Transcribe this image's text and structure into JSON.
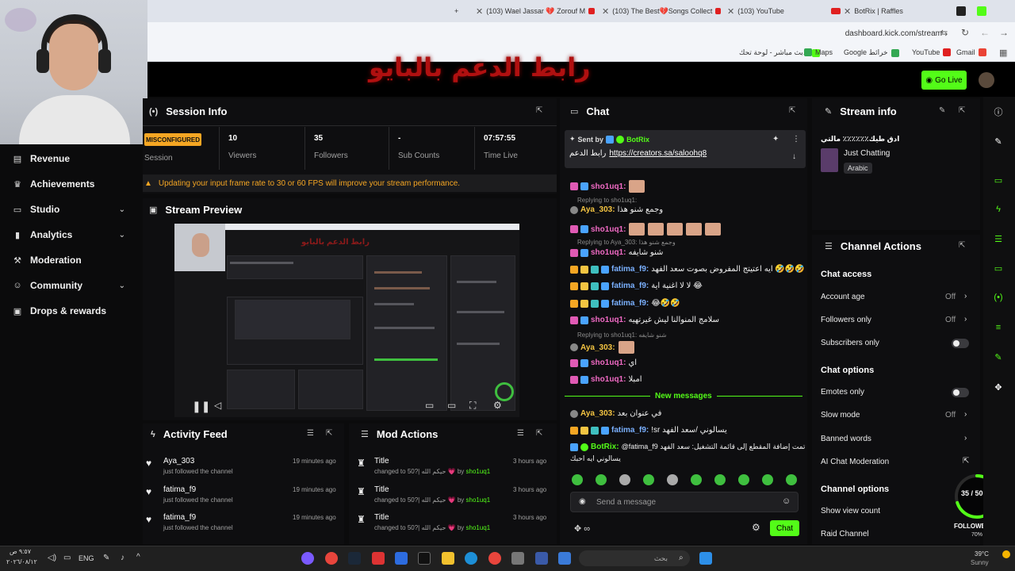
{
  "browser": {
    "new_tab": "+",
    "tabs": [
      {
        "title": "(103) Wael Jassar 💔 Zorouf M"
      },
      {
        "title": "(103) The Best💔Songs Collect"
      },
      {
        "title": "(103) YouTube"
      },
      {
        "title": "BotRix | Raffles"
      }
    ],
    "url": "dashboard.kick.com/stream",
    "bookmarks": [
      "بث مباشر - لوحة تحك...",
      "Maps",
      "Google خرائط",
      "YouTube",
      "Gmail"
    ]
  },
  "overlay_banner": "رابط الدعم بالبايو",
  "header": {
    "go_live": "Go Live"
  },
  "sidebar": {
    "items": [
      {
        "label": "Revenue"
      },
      {
        "label": "Achievements"
      },
      {
        "label": "Studio"
      },
      {
        "label": "Analytics"
      },
      {
        "label": "Moderation"
      },
      {
        "label": "Community"
      },
      {
        "label": "Drops & rewards"
      }
    ]
  },
  "session": {
    "title": "Session Info",
    "status": "MISCONFIGURED",
    "status_label": "Session",
    "viewers_value": "10",
    "viewers_label": "Viewers",
    "followers_value": "35",
    "followers_label": "Followers",
    "subs_value": "-",
    "subs_label": "Sub Counts",
    "time_value": "07:57:55",
    "time_label": "Time Live",
    "warning": "Updating your input frame rate to 30 or 60 FPS will improve your stream performance."
  },
  "preview": {
    "title": "Stream Preview",
    "overlay": "رابط الدعم بالبايو"
  },
  "activity": {
    "title": "Activity Feed",
    "items": [
      {
        "name": "Aya_303",
        "sub": "just followed the channel",
        "time": "19 minutes ago"
      },
      {
        "name": "fatima_f9",
        "sub": "just followed the channel",
        "time": "19 minutes ago"
      },
      {
        "name": "fatima_f9",
        "sub": "just followed the channel",
        "time": "19 minutes ago"
      }
    ]
  },
  "modactions": {
    "title": "Mod Actions",
    "items": [
      {
        "name": "Title",
        "sub": "changed to 50?| حيكم الله 💗",
        "by": "by",
        "user": "sho1uq1",
        "time": "3 hours ago"
      },
      {
        "name": "Title",
        "sub": "changed to 50?| حيكم الله 💗",
        "by": "by",
        "user": "sho1uq1",
        "time": "3 hours ago"
      },
      {
        "name": "Title",
        "sub": "changed to 50?| حيكم الله 💗",
        "by": "by",
        "user": "sho1uq1",
        "time": "3 hours ago"
      }
    ]
  },
  "chat": {
    "title": "Chat",
    "pinned_by_label": "Sent by",
    "pinned_user": "BotRix",
    "pinned_prefix": "رابط الدعم",
    "pinned_link": "https://creators.sa/saloohq8",
    "messages": {
      "m1_user": "sho1uq1:",
      "r1": "Replying to sho1uq1:",
      "m2_user": "Aya_303:",
      "m2_text": "وجمع شنو هذا",
      "m3_user": "sho1uq1:",
      "r2": "Replying to Aya_303: وجمع شنو هذا",
      "m4_user": "sho1uq1:",
      "m4_text": "شنو شايفه",
      "m5_user": "fatima_f9:",
      "m5_text": "ايه اعتيتج المفروض بصوت سعد الفهد 🤣🤣🤣",
      "m6_user": "fatima_f9:",
      "m6_text": "لا لا اغنية اية 😂",
      "m7_user": "fatima_f9:",
      "m7_text": "😂🤣🤣",
      "m8_user": "sho1uq1:",
      "m8_text": "سلامج المنوالنا ليش غيرتهيه",
      "r3": "Replying to sho1uq1: شنو شايفه",
      "m9_user": "Aya_303:",
      "m10_user": "sho1uq1:",
      "m10_text": "اي",
      "m11_user": "sho1uq1:",
      "m11_text": "امبلا",
      "new_messages": "New messages",
      "m12_user": "Aya_303:",
      "m12_text": "في عنوان بعد",
      "m13_user": "fatima_f9:",
      "m13_text": "!sr يسالوني /سعد الفهد",
      "m14_user": "BotRix:",
      "m14_text": "@fatima_f9 تمت إضافة المقطع إلى قائمة التشغيل: سعد الفهد",
      "m14_text2": "يسالوني ايه احبك"
    },
    "input_placeholder": "Send a message",
    "chat_button": "Chat"
  },
  "streaminfo": {
    "title": "Stream info",
    "stream_title": "ادق طيك٪٪٪٪٪٪ مالتي",
    "category": "Just Chatting",
    "language": "Arabic"
  },
  "channel_actions": {
    "title": "Channel Actions",
    "chat_access": "Chat access",
    "account_age": "Account age",
    "account_age_value": "Off",
    "followers_only": "Followers only",
    "followers_only_value": "Off",
    "subscribers_only": "Subscribers only",
    "chat_options": "Chat options",
    "emotes_only": "Emotes only",
    "slow_mode": "Slow mode",
    "slow_mode_value": "Off",
    "banned_words": "Banned words",
    "ai_mod": "AI Chat Moderation",
    "channel_options": "Channel options",
    "show_view_count": "Show view count",
    "raid_channel": "Raid Channel"
  },
  "goal": {
    "value": "35 / 50",
    "label": "FOLLOWERS",
    "percent": "70%",
    "progress": 0.7
  },
  "taskbar": {
    "time": "٩:٥٧ ص",
    "date": "٢٠٢٦/٠٨/١٢",
    "lang": "ENG",
    "search": "بحث",
    "weather_temp": "39°C",
    "weather_desc": "Sunny"
  },
  "colors": {
    "accent": "#53fc18",
    "warning": "#f5a623",
    "panel": "#18181a"
  }
}
